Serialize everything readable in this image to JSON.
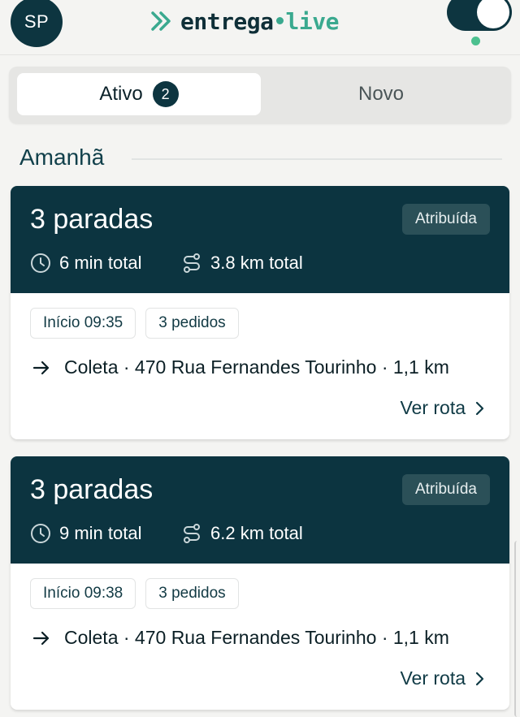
{
  "header": {
    "avatar_initials": "SP",
    "logo_left": "entrega",
    "logo_right": "live",
    "toggle_on": true,
    "status_color": "#4cc08f"
  },
  "tabs": {
    "active_label": "Ativo",
    "active_count": "2",
    "new_label": "Novo"
  },
  "section": {
    "title": "Amanhã"
  },
  "cards": [
    {
      "title": "3 paradas",
      "status": "Atribuída",
      "time_total": "6 min total",
      "distance_total": "3.8 km total",
      "start": "Início 09:35",
      "orders": "3 pedidos",
      "stop": "Coleta · 470 Rua Fernandes Tourinho · 1,1 km",
      "route_link": "Ver rota"
    },
    {
      "title": "3 paradas",
      "status": "Atribuída",
      "time_total": "9 min total",
      "distance_total": "6.2 km total",
      "start": "Início 09:38",
      "orders": "3 pedidos",
      "stop": "Coleta · 470 Rua Fernandes Tourinho · 1,1 km",
      "route_link": "Ver rota"
    }
  ],
  "colors": {
    "primary": "#0c3440",
    "accent": "#3aa98f",
    "background": "#f4f4f2"
  },
  "icons": [
    "chevrons-right-icon",
    "clock-icon",
    "route-icon",
    "arrow-right-icon",
    "chevron-right-icon"
  ]
}
